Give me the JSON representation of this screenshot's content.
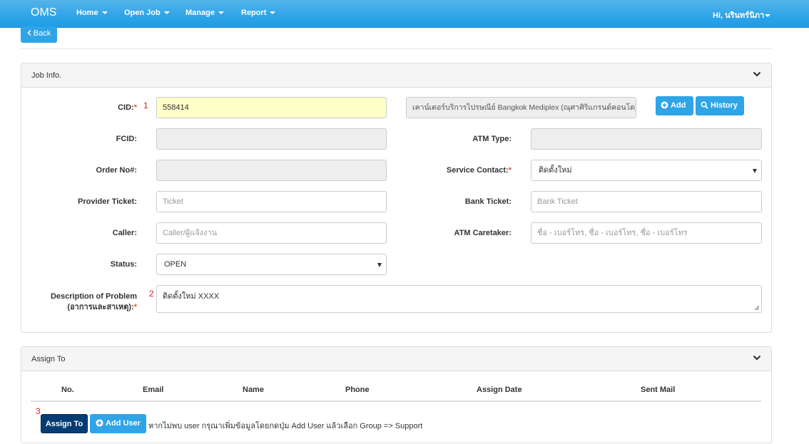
{
  "navbar": {
    "brand": "OMS",
    "items": [
      {
        "label": "Home"
      },
      {
        "label": "Open Job"
      },
      {
        "label": "Manage"
      },
      {
        "label": "Report"
      }
    ],
    "user_greeting": "Hi, นรินทร์นิภา"
  },
  "back_label": "Back",
  "job_panel": {
    "title": "Job Info.",
    "cid": {
      "label": "CID:",
      "required": "*",
      "marker": "1",
      "value": "558414"
    },
    "cid_name": "เคาน์เตอร์บริการไปรษณีย์ Bangkok Mediplex (ณุศาศิริแกรนด์คอนโด)",
    "add_label": "Add",
    "history_label": "History",
    "fcid": {
      "label": "FCID:",
      "value": ""
    },
    "atm_type": {
      "label": "ATM Type:",
      "value": ""
    },
    "order_no": {
      "label": "Order No#:",
      "value": ""
    },
    "service_contact": {
      "label": "Service Contact:",
      "required": "*",
      "value": "ติดตั้งใหม่"
    },
    "provider_ticket": {
      "label": "Provider Ticket:",
      "placeholder": "Ticket"
    },
    "bank_ticket": {
      "label": "Bank Ticket:",
      "placeholder": "Bank Ticket"
    },
    "caller": {
      "label": "Caller:",
      "placeholder": "Caller/ผู้แจ้งงาน"
    },
    "atm_caretaker": {
      "label": "ATM Caretaker:",
      "placeholder": "ชื่อ - เบอร์โทร, ชื่อ - เบอร์โทร, ชื่อ - เบอร์โทร"
    },
    "status": {
      "label": "Status:",
      "value": "OPEN"
    },
    "description": {
      "label_line1": "Description of Problem",
      "label_line2": "(อาการและสาเหตุ):",
      "required": "*",
      "marker": "2",
      "value": "ติดตั้งใหม่ XXXX"
    }
  },
  "assign_panel": {
    "title": "Assign To",
    "columns": [
      "No.",
      "Email",
      "Name",
      "Phone",
      "Assign Date",
      "Sent Mail"
    ],
    "marker": "3",
    "assign_label": "Assign To",
    "add_user_label": "Add User",
    "hint": "หากไม่พบ user กรุณาเพิ่มข้อมูลโดยกดปุ่ม Add User แล้วเลือก Group => Support"
  },
  "colors": {
    "navbar": "#2fa4e7",
    "primary_dark": "#033c73",
    "cid_bg": "#ffffc8",
    "required": "#d9534f"
  },
  "icons": [
    "caret-down-icon",
    "chevron-left-icon",
    "chevron-down-icon",
    "plus-circle-icon",
    "search-icon",
    "resize-grip-icon"
  ]
}
